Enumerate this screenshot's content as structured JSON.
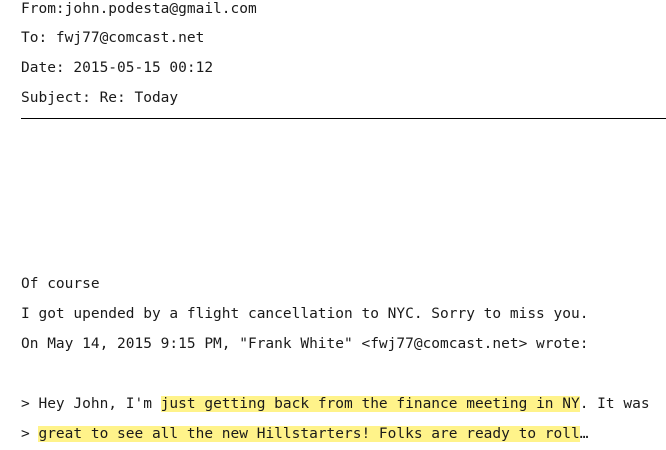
{
  "header": {
    "from": "From:john.podesta@gmail.com",
    "to": "To: fwj77@comcast.net",
    "date": "Date: 2015-05-15 00:12",
    "subject": "Subject: Re: Today"
  },
  "body": {
    "line1": "Of course",
    "line2": "I got upended by a flight cancellation to NYC. Sorry to miss you.",
    "line3": "On May 14, 2015 9:15 PM, \"Frank White\" <fwj77@comcast.net> wrote:"
  },
  "quote": {
    "q1_prefix": "> Hey John, I'm ",
    "q1_highlight": "just getting back from the finance meeting in NY",
    "q1_suffix": ". It was",
    "q2_prefix": "> ",
    "q2_highlight": "great to see all the new Hillstarters! Folks are ready to roll",
    "q2_suffix": "…"
  },
  "colors": {
    "highlight": "#fff38a",
    "text": "#1a1a1a",
    "rule": "#000000"
  }
}
